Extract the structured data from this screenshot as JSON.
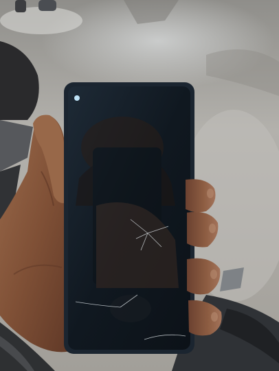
{
  "photo": {
    "subject": "hand-holding-smartphone-with-cracked-screen",
    "colors": {
      "ground": "#a9a7a2",
      "ground_dark": "#6f6e6b",
      "skin": "#8a5a3f",
      "skin_shadow": "#5a3524",
      "phone_bezel": "#1c2733",
      "screen": "#141c24"
    }
  }
}
